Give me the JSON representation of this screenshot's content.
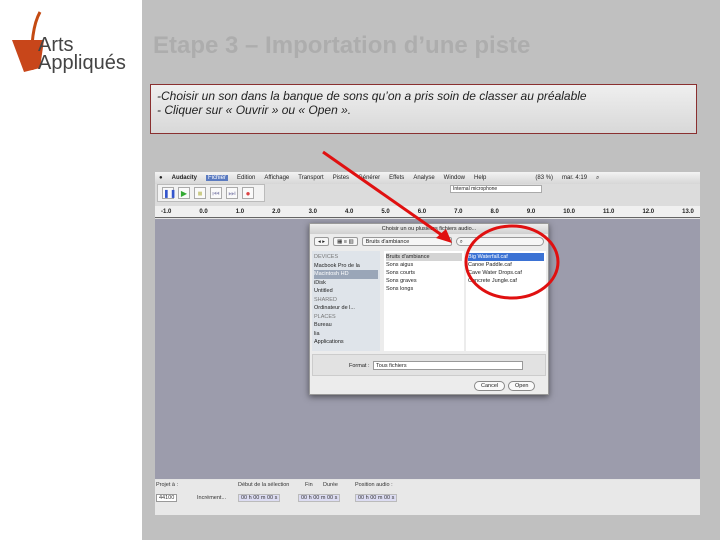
{
  "logo": {
    "line1": "Arts",
    "line2": "Appliqués"
  },
  "slide": {
    "title": "Etape 3 – Importation d’une piste",
    "instructions": [
      "-Choisir un son dans la banque de sons qu’on a pris soin de classer au préalable",
      "- Cliquer sur « Ouvrir » ou « Open »."
    ]
  },
  "menubar": {
    "items": [
      "Audacity",
      "Fichier",
      "Edition",
      "Affichage",
      "Transport",
      "Pistes",
      "Générer",
      "Effets",
      "Analyse",
      "Window",
      "Help"
    ],
    "clock": "mar. 4:19",
    "battery": "(83 %)"
  },
  "toolbar": {
    "input_device": "Internal microphone",
    "transport": [
      "pause",
      "play",
      "stop",
      "skip-start",
      "skip-end",
      "record"
    ]
  },
  "ruler": {
    "ticks": [
      "-1.0",
      "0.0",
      "1.0",
      "2.0",
      "3.0",
      "4.0",
      "5.0",
      "6.0",
      "7.0",
      "8.0",
      "9.0",
      "10.0",
      "11.0",
      "12.0",
      "13.0"
    ]
  },
  "dialog": {
    "title": "Choisir un ou plusieurs fichiers audio...",
    "location": "Bruits d'ambiance",
    "search_placeholder": "",
    "sidebar": {
      "devices_header": "DEVICES",
      "devices": [
        "Macbook Pro de la",
        "Macintosh HD",
        "iDisk",
        "Untitled"
      ],
      "shared_header": "SHARED",
      "shared": [
        "Ordinateur de l..."
      ],
      "places_header": "PLACES",
      "places": [
        "Bureau",
        "lia",
        "Applications"
      ]
    },
    "folders": [
      "Bruits d'ambiance",
      "Sons aigus",
      "Sons courts",
      "Sons graves",
      "Sons longs"
    ],
    "files": [
      "Big Waterfall.caf",
      "Canoe Paddle.caf",
      "Cave Water Drops.caf",
      "Concrete Jungle.caf"
    ],
    "format_label": "Format :",
    "format_value": "Tous fichiers",
    "cancel": "Cancel",
    "open": "Open"
  },
  "bottom": {
    "rate_label": "Projet à :",
    "rate": "44100",
    "snap": "Incrément...",
    "selection_label": "Début de la sélection",
    "end": "Fin",
    "length": "Durée",
    "position_label": "Position audio :",
    "time1": "00 h 00 m 00 s",
    "time2": "00 h 00 m 00 s",
    "time3": "00 h 00 m 00 s"
  },
  "colors": {
    "annotation": "#e01010",
    "background": "#c0c0c0"
  }
}
